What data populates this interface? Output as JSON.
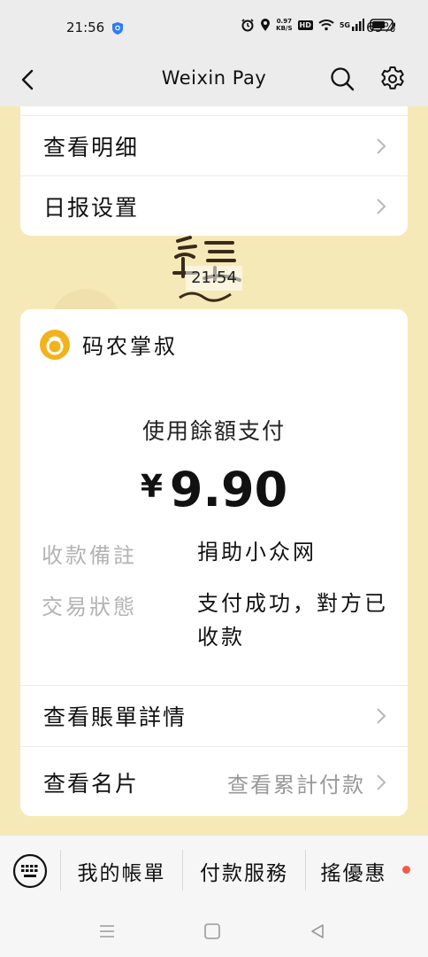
{
  "status_bar": {
    "time": "21:56",
    "net_speed_value": "0.97",
    "net_speed_unit": "KB/S",
    "hd_badge": "HD",
    "signal_label": "5G",
    "battery_percent": "69%"
  },
  "nav": {
    "title": "Weixin Pay",
    "icons": [
      "back-arrow-icon",
      "search-icon",
      "gear-icon"
    ]
  },
  "top_card": {
    "rows": [
      {
        "label": "查看明细"
      },
      {
        "label": "日报设置"
      }
    ]
  },
  "sticker": {
    "time_label": "21:54"
  },
  "payment": {
    "payee_name": "码农掌叔",
    "method": "使用餘額支付",
    "currency_symbol": "¥",
    "amount": "9.90",
    "details": [
      {
        "label": "收款備註",
        "value": "捐助小众网"
      },
      {
        "label": "交易狀態",
        "value": "支付成功，對方已收款"
      }
    ],
    "links": [
      {
        "label": "查看賬單詳情",
        "value": ""
      },
      {
        "label": "查看名片",
        "value": "查看累計付款"
      }
    ]
  },
  "bottom_menu": {
    "items": [
      "我的帳單",
      "付款服務",
      "搖優惠"
    ],
    "has_notification_dot": true,
    "accent_dot_color": "#f35a4a"
  },
  "colors": {
    "background": "#f5e8b4",
    "payee_icon": "#f2b21b"
  }
}
